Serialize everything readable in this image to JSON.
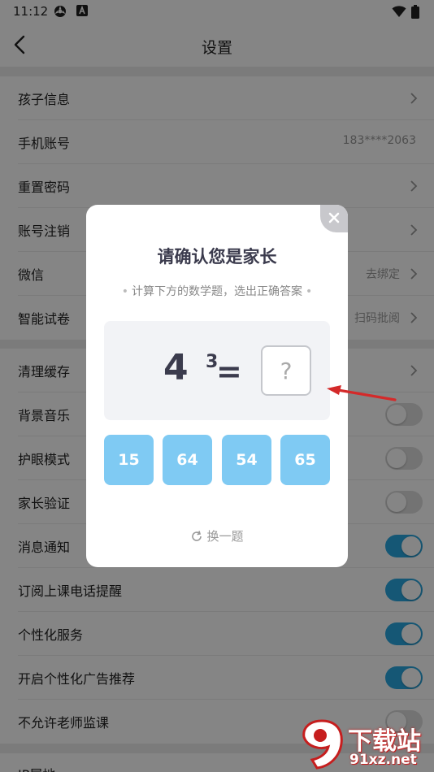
{
  "status_bar": {
    "time": "11:12",
    "icons": [
      "sync-icon",
      "notification-a-icon",
      "wifi-icon",
      "battery-icon"
    ]
  },
  "app_bar": {
    "title": "设置",
    "back_icon": "chevron-left-icon"
  },
  "settings": {
    "group1": [
      {
        "label": "孩子信息",
        "value": "",
        "control": "chevron"
      },
      {
        "label": "手机账号",
        "value": "183****2063",
        "control": "none"
      },
      {
        "label": "重置密码",
        "value": "",
        "control": "chevron"
      },
      {
        "label": "账号注销",
        "value": "",
        "control": "chevron"
      },
      {
        "label": "微信",
        "value": "去绑定",
        "control": "chevron"
      },
      {
        "label": "智能试卷",
        "value": "扫码批阅",
        "control": "chevron"
      }
    ],
    "group2": [
      {
        "label": "清理缓存",
        "control": "chevron"
      },
      {
        "label": "背景音乐",
        "control": "toggle",
        "on": false
      },
      {
        "label": "护眼模式",
        "control": "toggle",
        "on": false
      },
      {
        "label": "家长验证",
        "control": "toggle",
        "on": false
      },
      {
        "label": "消息通知",
        "control": "toggle",
        "on": true
      },
      {
        "label": "订阅上课电话提醒",
        "control": "toggle",
        "on": true
      },
      {
        "label": "个性化服务",
        "control": "toggle",
        "on": true
      },
      {
        "label": "开启个性化广告推荐",
        "control": "toggle",
        "on": true
      },
      {
        "label": "不允许老师监课",
        "control": "toggle",
        "on": false
      }
    ],
    "group3": [
      {
        "label": "IP属地"
      }
    ]
  },
  "dialog": {
    "title": "请确认您是家长",
    "subtitle": "计算下方的数学题，选出正确答案",
    "question": {
      "base": "4",
      "exponent": "3",
      "equals": "=",
      "answer_placeholder": "?"
    },
    "options": [
      "15",
      "64",
      "54",
      "65"
    ],
    "refresh_label": "换一题",
    "close_icon": "close-icon"
  },
  "watermark": {
    "text": "下载站",
    "url": "91xz.net",
    "badge": "9"
  },
  "colors": {
    "accent": "#2aa7e0",
    "option_bg": "#7fcaf3",
    "annotation_arrow": "#d42a2a"
  }
}
